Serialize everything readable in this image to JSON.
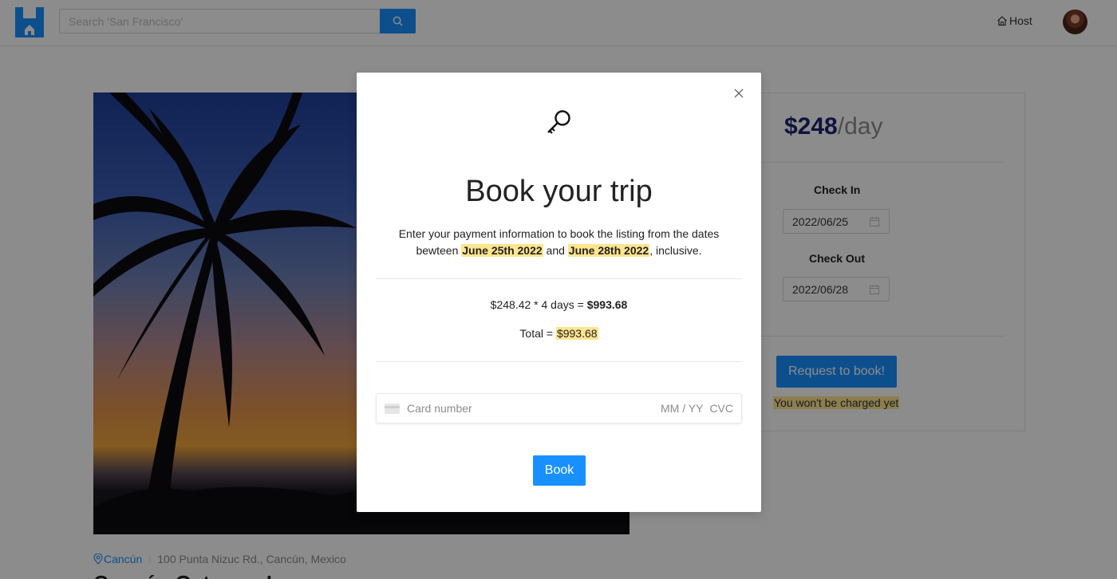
{
  "header": {
    "search_placeholder": "Search 'San Francisco'",
    "host_label": "Host"
  },
  "listing": {
    "city": "Cancún",
    "address": "100 Punta Nizuc Rd., Cancún, Mexico",
    "title_partial": "Cancún Getaway Luxury"
  },
  "booking": {
    "price": "$248",
    "price_unit": "/day",
    "check_in_label": "Check In",
    "check_in_value": "2022/06/25",
    "check_out_label": "Check Out",
    "check_out_value": "2022/06/28",
    "request_button": "Request to book!",
    "charge_note": "You won't be charged yet"
  },
  "modal": {
    "title": "Book your trip",
    "desc_part1": "Enter your payment information to book the listing from the dates bewteen",
    "date_start": "June 25th 2022",
    "desc_and": "and",
    "date_end": "June 28th 2022",
    "desc_part2": ", inclusive.",
    "calc_expression": "$248.42 * 4 days =",
    "calc_result": "$993.68",
    "total_label": "Total =",
    "total_value": "$993.68",
    "card_placeholder": "Card number",
    "expiry_placeholder": "MM / YY",
    "cvc_placeholder": "CVC",
    "book_button": "Book"
  },
  "colors": {
    "primary": "#1890ff",
    "highlight": "#ffe58f",
    "price": "#1d2671"
  },
  "icons": [
    "logo-icon",
    "search-icon",
    "home-icon",
    "calendar-icon",
    "location-pin-icon",
    "close-icon",
    "key-icon",
    "credit-card-icon"
  ]
}
